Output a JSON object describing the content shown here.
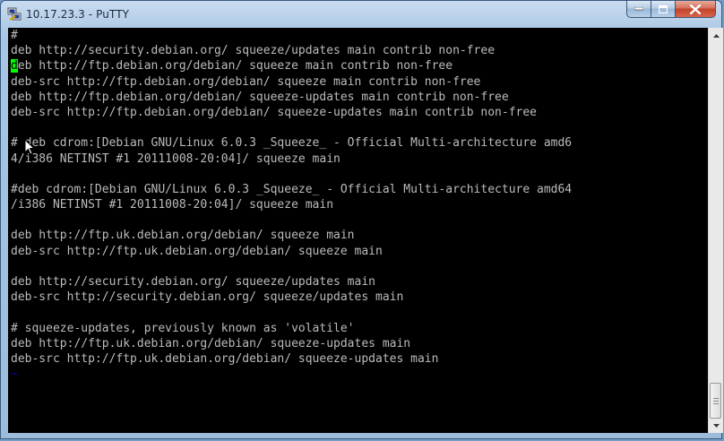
{
  "window": {
    "title": "10.17.23.3 - PuTTY",
    "icon": "putty-icon"
  },
  "terminal": {
    "cursor_char": "d",
    "lines": [
      "#",
      "deb http://security.debian.org/ squeeze/updates main contrib non-free",
      "eb http://ftp.debian.org/debian/ squeeze main contrib non-free",
      "deb-src http://ftp.debian.org/debian/ squeeze main contrib non-free",
      "deb http://ftp.debian.org/debian/ squeeze-updates main contrib non-free",
      "deb-src http://ftp.debian.org/debian/ squeeze-updates main contrib non-free",
      "",
      "# deb cdrom:[Debian GNU/Linux 6.0.3 _Squeeze_ - Official Multi-architecture amd6",
      "4/i386 NETINST #1 20111008-20:04]/ squeeze main",
      "",
      "#deb cdrom:[Debian GNU/Linux 6.0.3 _Squeeze_ - Official Multi-architecture amd64",
      "/i386 NETINST #1 20111008-20:04]/ squeeze main",
      "",
      "deb http://ftp.uk.debian.org/debian/ squeeze main",
      "deb-src http://ftp.uk.debian.org/debian/ squeeze main",
      "",
      "deb http://security.debian.org/ squeeze/updates main",
      "deb-src http://security.debian.org/ squeeze/updates main",
      "",
      "# squeeze-updates, previously known as 'volatile'",
      "deb http://ftp.uk.debian.org/debian/ squeeze-updates main",
      "deb-src http://ftp.uk.debian.org/debian/ squeeze-updates main",
      "~"
    ],
    "colors": {
      "background": "#000000",
      "foreground": "#bbbbbb",
      "cursor": "#00ff00",
      "tilde": "#0000bb"
    }
  }
}
